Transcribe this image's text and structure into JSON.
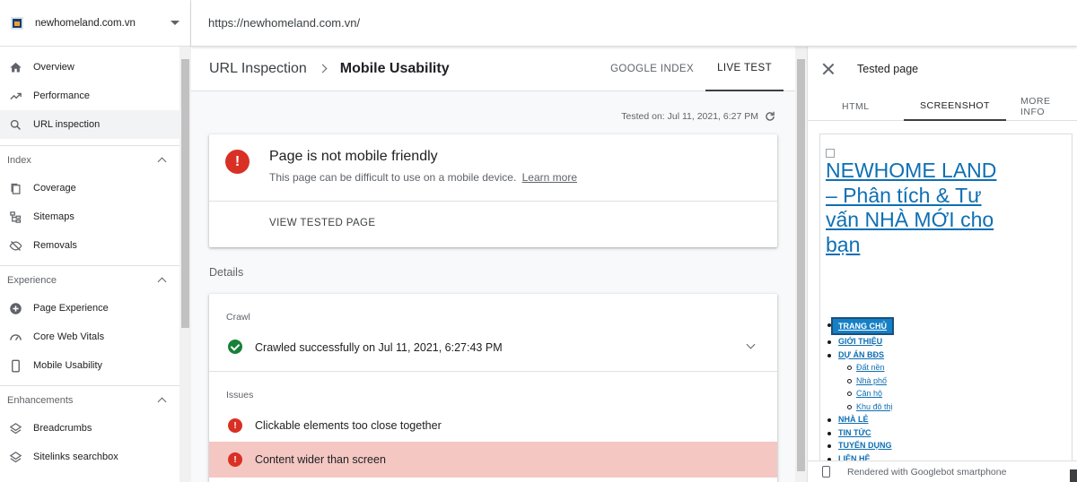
{
  "property": {
    "name": "newhomeland.com.vn"
  },
  "topbar": {
    "url": "https://newhomeland.com.vn/"
  },
  "sidebar": {
    "main_items": [
      {
        "label": "Overview",
        "icon": "home-icon"
      },
      {
        "label": "Performance",
        "icon": "trending-icon"
      },
      {
        "label": "URL inspection",
        "icon": "search-icon",
        "active": true
      }
    ],
    "sections": [
      {
        "title": "Index",
        "items": [
          {
            "label": "Coverage",
            "icon": "coverage-icon"
          },
          {
            "label": "Sitemaps",
            "icon": "sitemap-icon"
          },
          {
            "label": "Removals",
            "icon": "removals-icon"
          }
        ]
      },
      {
        "title": "Experience",
        "items": [
          {
            "label": "Page Experience",
            "icon": "page-experience-icon"
          },
          {
            "label": "Core Web Vitals",
            "icon": "gauge-icon"
          },
          {
            "label": "Mobile Usability",
            "icon": "phone-icon"
          }
        ]
      },
      {
        "title": "Enhancements",
        "items": [
          {
            "label": "Breadcrumbs",
            "icon": "layers-icon"
          },
          {
            "label": "Sitelinks searchbox",
            "icon": "layers-icon"
          }
        ]
      }
    ]
  },
  "header": {
    "crumb_1": "URL Inspection",
    "crumb_2": "Mobile Usability",
    "tabs": [
      "GOOGLE INDEX",
      "LIVE TEST"
    ],
    "active_tab": "LIVE TEST"
  },
  "tested_on": "Tested on: Jul 11, 2021, 6:27 PM",
  "status": {
    "title": "Page is not mobile friendly",
    "subtitle": "This page can be difficult to use on a mobile device.",
    "link": "Learn more",
    "button": "VIEW TESTED PAGE"
  },
  "details": {
    "label": "Details",
    "crawl_label": "Crawl",
    "crawl_text": "Crawled successfully on Jul 11, 2021, 6:27:43 PM",
    "issues_label": "Issues",
    "issues": [
      "Clickable elements too close together",
      "Content wider than screen"
    ]
  },
  "panel": {
    "title": "Tested page",
    "tabs": [
      "HTML",
      "SCREENSHOT",
      "MORE INFO"
    ],
    "active_tab": "SCREENSHOT",
    "site_title": "NEWHOME LAND – Phân tích & Tư vấn NHÀ MỚI cho bạn",
    "menu": [
      {
        "label": "TRANG CHỦ",
        "level": "top",
        "active": true
      },
      {
        "label": "GIỚI THIỆU",
        "level": "top"
      },
      {
        "label": "DỰ ÁN BĐS",
        "level": "top"
      },
      {
        "label": "Đất nền",
        "level": "sub"
      },
      {
        "label": "Nhà phố",
        "level": "sub"
      },
      {
        "label": "Căn hộ",
        "level": "sub"
      },
      {
        "label": "Khu đô thị",
        "level": "sub"
      },
      {
        "label": "NHÀ LẺ",
        "level": "top"
      },
      {
        "label": "TIN TỨC",
        "level": "top"
      },
      {
        "label": "TUYỂN DỤNG",
        "level": "top"
      },
      {
        "label": "LIÊN HỆ",
        "level": "top"
      }
    ],
    "footer": "Rendered with Googlebot smartphone"
  },
  "colors": {
    "error": "#d93025",
    "success": "#188038",
    "highlight": "#f4c7c3",
    "link": "#0e6fb3"
  }
}
